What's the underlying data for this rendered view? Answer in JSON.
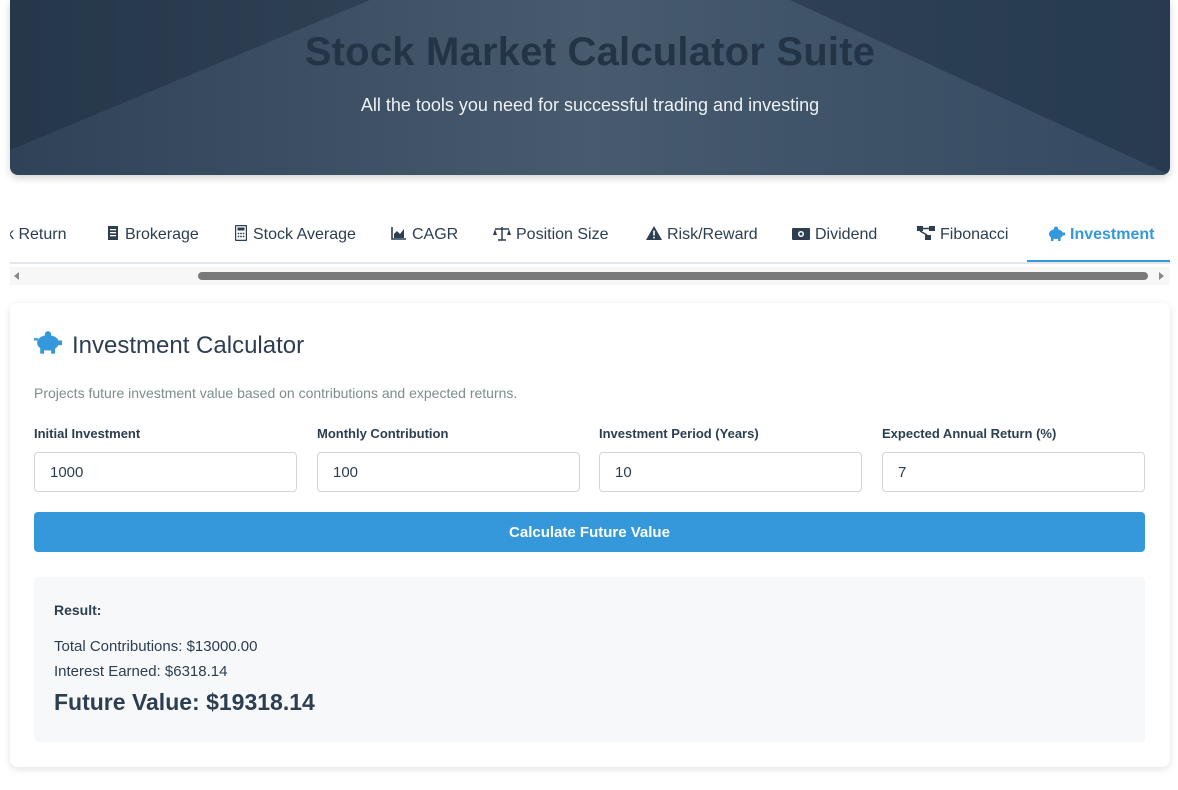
{
  "header": {
    "title": "Stock Market Calculator Suite",
    "subtitle": "All the tools you need for successful trading and investing"
  },
  "tabs": [
    {
      "label": "k Return",
      "icon": "none"
    },
    {
      "label": "Brokerage",
      "icon": "receipt-icon"
    },
    {
      "label": "Stock Average",
      "icon": "calculator-icon"
    },
    {
      "label": "CAGR",
      "icon": "area-chart-icon"
    },
    {
      "label": "Position Size",
      "icon": "balance-scale-icon"
    },
    {
      "label": "Risk/Reward",
      "icon": "warning-icon"
    },
    {
      "label": "Dividend",
      "icon": "money-bill-icon"
    },
    {
      "label": "Fibonacci",
      "icon": "project-diagram-icon"
    },
    {
      "label": "Investment",
      "icon": "piggy-bank-icon",
      "active": true
    }
  ],
  "calculator": {
    "title": "Investment Calculator",
    "icon": "piggy-bank-icon",
    "description": "Projects future investment value based on contributions and expected returns.",
    "fields": [
      {
        "label": "Initial Investment",
        "value": "1000"
      },
      {
        "label": "Monthly Contribution",
        "value": "100"
      },
      {
        "label": "Investment Period (Years)",
        "value": "10"
      },
      {
        "label": "Expected Annual Return (%)",
        "value": "7"
      }
    ],
    "button_label": "Calculate Future Value"
  },
  "result": {
    "label": "Result:",
    "total_contributions": "Total Contributions: $13000.00",
    "interest_earned": "Interest Earned: $6318.14",
    "future_value": "Future Value: $19318.14"
  },
  "colors": {
    "accent": "#3498db",
    "text": "#2c3e50",
    "muted": "#7f8c8d"
  }
}
